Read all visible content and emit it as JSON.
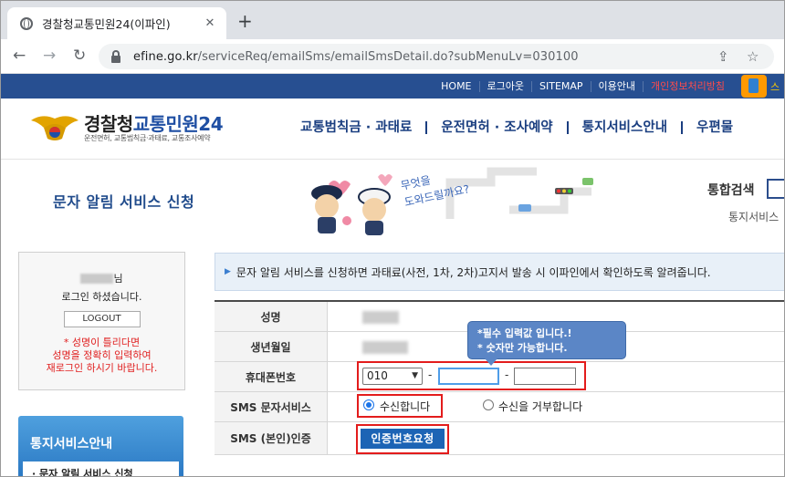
{
  "browser": {
    "tab_title": "경찰청교통민원24(이파인)",
    "tab_close": "✕",
    "new_tab": "+",
    "back": "←",
    "forward": "→",
    "reload": "↻",
    "url_host": "efine.go.kr",
    "url_path": "/serviceReq/emailSms/emailSmsDetail.do?subMenuLv=030100",
    "share_icon": "⇪",
    "bookmark_icon": "☆"
  },
  "topnav": {
    "links": [
      "HOME",
      "로그아웃",
      "SITEMAP",
      "이용안내",
      "개인정보처리방침"
    ],
    "mobile_label": "스"
  },
  "header": {
    "site_name_part1": "경찰청",
    "site_name_part2": "교통민원24",
    "site_sub": "운전면허, 교통범칙금·과태료, 교통조사예약",
    "menu": [
      "교통범칙금 · 과태료",
      "운전면허 · 조사예약",
      "통지서비스안내",
      "우편물"
    ]
  },
  "banner": {
    "page_title": "문자 알림 서비스 신청",
    "cartoon_text1": "무엇을",
    "cartoon_text2": "도와드릴까요?",
    "search_label": "통합검색",
    "crumb": "통지서비스"
  },
  "sidebar": {
    "name_suffix": "님",
    "login_msg": "로그인 하셨습니다.",
    "logout_label": "LOGOUT",
    "warn_line1": "* 성명이 틀리다면",
    "warn_line2": "성명을 정확히 입력하여",
    "warn_line3": "재로그인 하시기 바랍니다.",
    "panel_title": "통지서비스안내",
    "panel_item": "· 문자 알림 서비스 신청"
  },
  "info": {
    "text": "문자 알림 서비스를 신청하면 과태료(사전, 1차, 2차)고지서 발송 시 이파인에서 확인하도록 알려줍니다."
  },
  "form": {
    "labels": {
      "name": "성명",
      "birth": "생년월일",
      "phone": "휴대폰번호",
      "sms": "SMS 문자서비스",
      "auth": "SMS (본인)인증"
    },
    "phone_prefix": "010",
    "phone_mid": "",
    "phone_last": "",
    "dash": "-",
    "radio_accept": "수신합니다",
    "radio_reject": "수신을 거부합니다",
    "auth_button": "인증번호요청",
    "tooltip_line1": "*필수 입력값 입니다.!",
    "tooltip_line2": "* 숫자만 가능합니다.",
    "highlight_color": "#e31c1c"
  }
}
